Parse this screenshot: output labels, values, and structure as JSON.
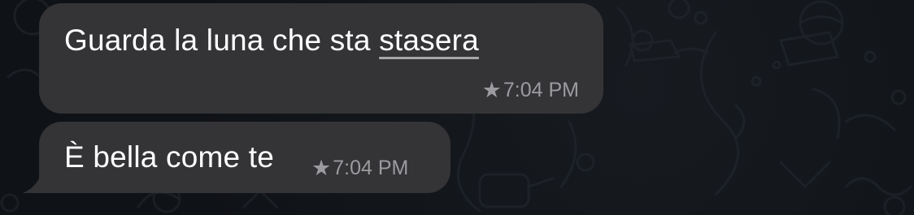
{
  "chat": {
    "background_color": "#0f1216",
    "bubble_color": "#343437",
    "messages": [
      {
        "text_before": "Guarda la luna che sta ",
        "text_link": "stasera",
        "starred": true,
        "star_icon": "★",
        "time": "7:04 PM"
      },
      {
        "text": "È bella come te",
        "starred": true,
        "star_icon": "★",
        "time": "7:04 PM"
      }
    ]
  }
}
